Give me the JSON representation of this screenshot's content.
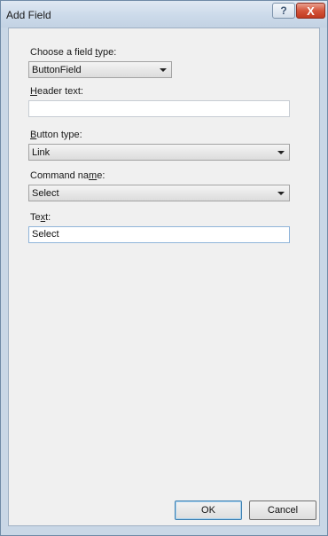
{
  "window": {
    "title": "Add Field",
    "help_glyph": "?",
    "close_glyph": "X"
  },
  "form": {
    "field_type": {
      "label_parts": [
        "Choose a field ",
        "t",
        "ype:"
      ],
      "value": "ButtonField"
    },
    "header_text": {
      "label_parts": [
        "H",
        "eader text:"
      ],
      "value": ""
    },
    "button_type": {
      "label_parts": [
        "B",
        "utton type:"
      ],
      "value": "Link"
    },
    "command_name": {
      "label_parts": [
        "Command na",
        "m",
        "e:"
      ],
      "value": "Select"
    },
    "text": {
      "label_parts": [
        "Te",
        "x",
        "t:"
      ],
      "value": "Select"
    }
  },
  "buttons": {
    "ok": "OK",
    "cancel": "Cancel"
  },
  "icons": {
    "help": "help-icon",
    "close": "close-icon",
    "dropdown": "chevron-down-icon"
  }
}
